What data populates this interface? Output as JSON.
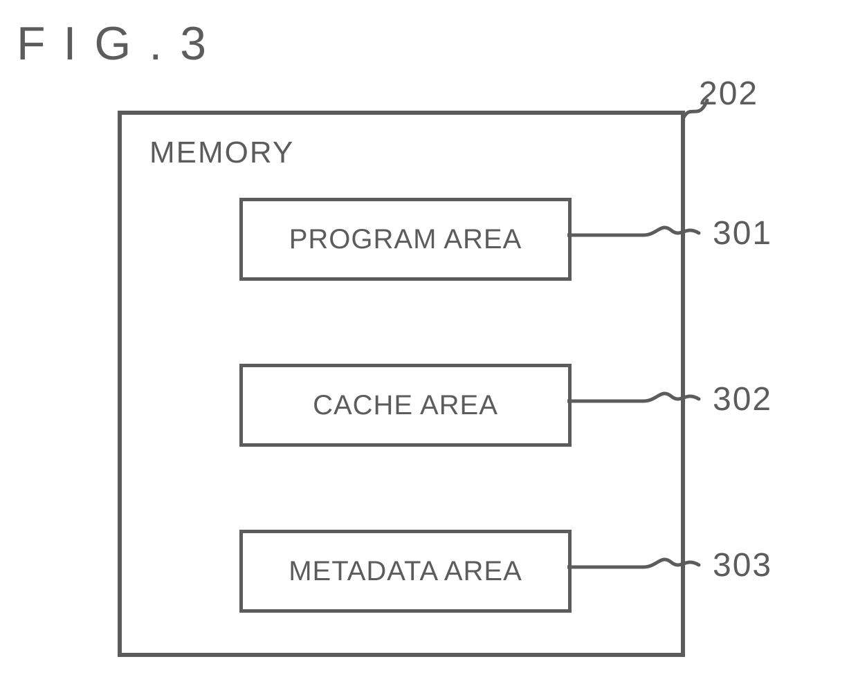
{
  "figure_title": "FIG.3",
  "memory": {
    "label": "MEMORY",
    "ref": "202",
    "areas": [
      {
        "label": "PROGRAM AREA",
        "ref": "301"
      },
      {
        "label": "CACHE AREA",
        "ref": "302"
      },
      {
        "label": "METADATA AREA",
        "ref": "303"
      }
    ]
  }
}
